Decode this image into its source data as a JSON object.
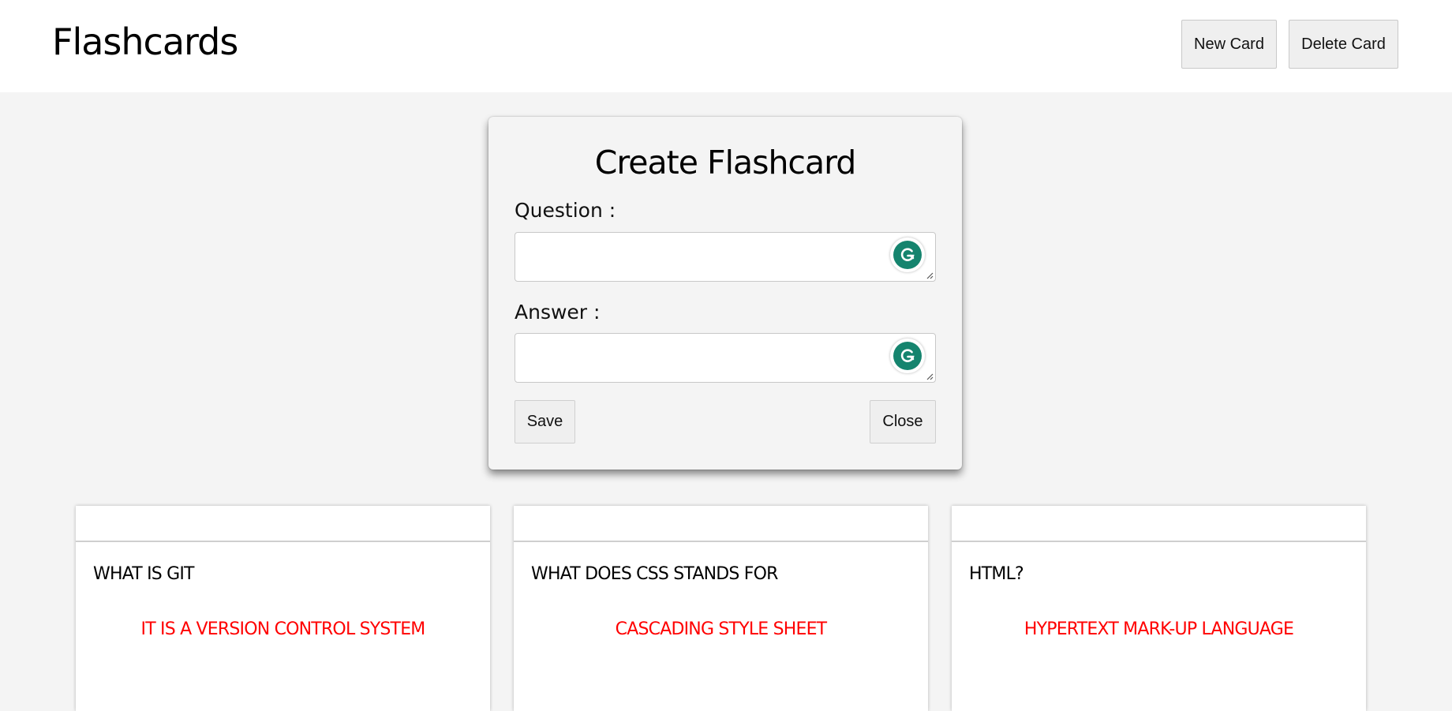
{
  "header": {
    "title": "Flashcards",
    "new_card_label": "New Card",
    "delete_card_label": "Delete Card"
  },
  "modal": {
    "title": "Create Flashcard",
    "question_label": "Question :",
    "question_value": "",
    "answer_label": "Answer :",
    "answer_value": "",
    "save_label": "Save",
    "close_label": "Close",
    "grammarly_icon": "grammarly-icon"
  },
  "cards": [
    {
      "question": "WHAT IS GIT",
      "answer": "IT IS A VERSION CONTROL SYSTEM"
    },
    {
      "question": "WHAT DOES CSS STANDS FOR",
      "answer": "CASCADING STYLE SHEET"
    },
    {
      "question": "HTML?",
      "answer": "HYPERTEXT MARK-UP LANGUAGE"
    }
  ],
  "colors": {
    "answer_text": "#ff0000",
    "grammarly": "#15846e",
    "page_background": "#f4f4f4"
  }
}
